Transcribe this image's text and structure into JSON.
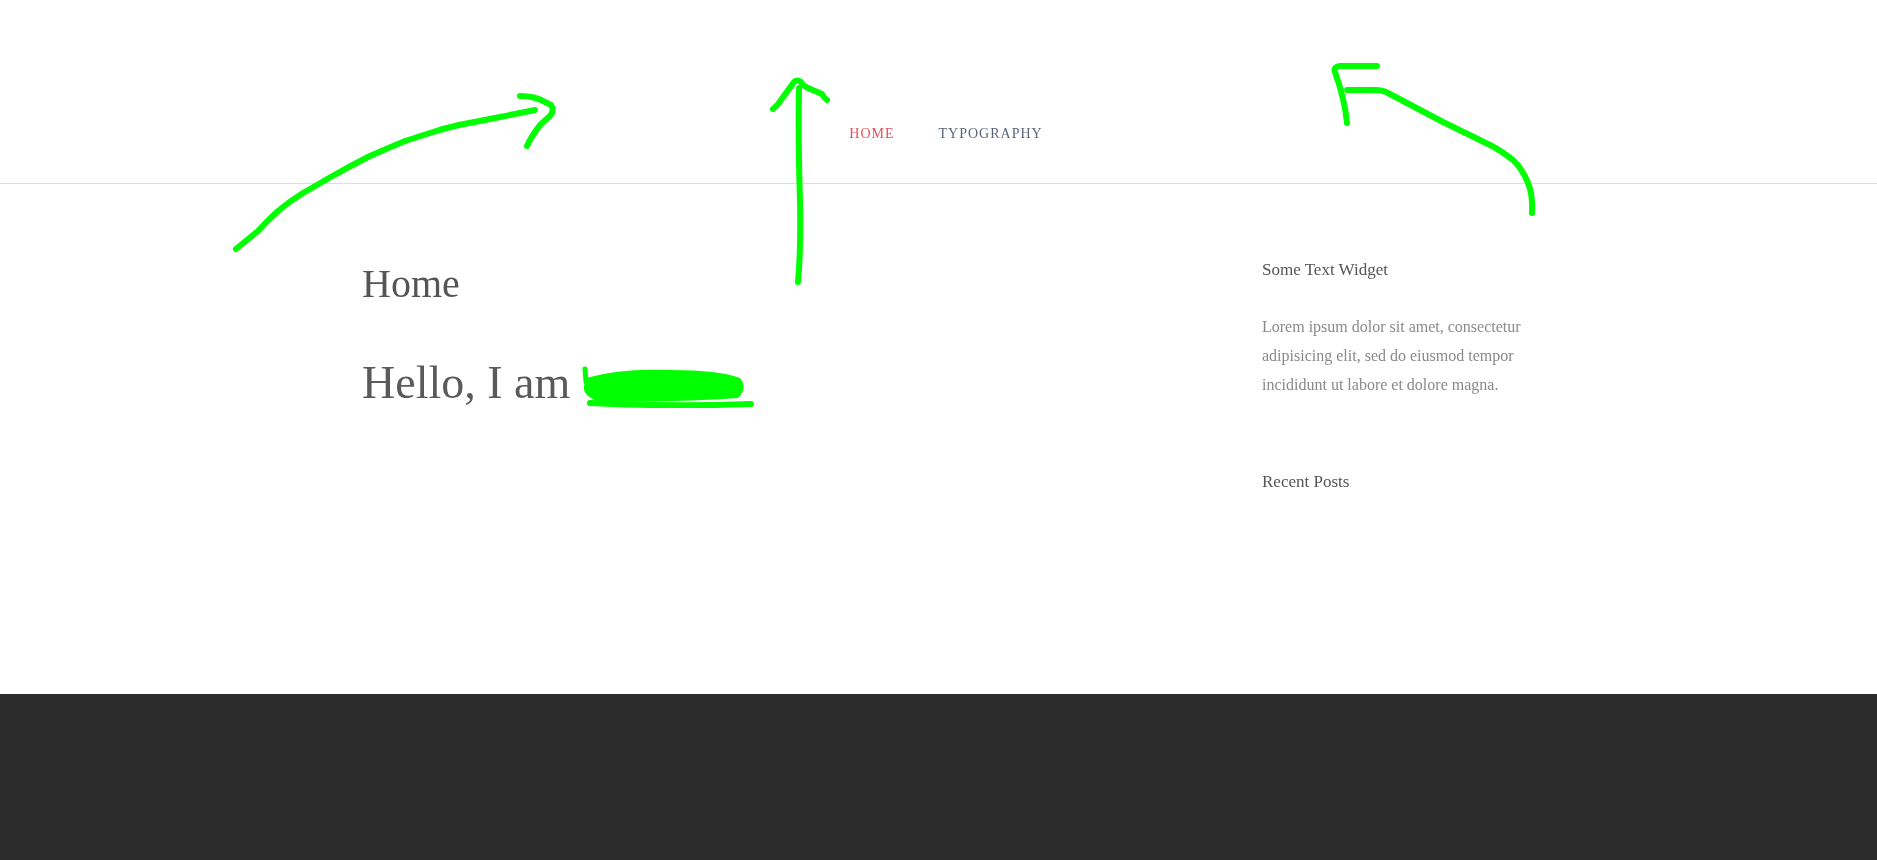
{
  "header": {
    "nav": [
      {
        "label": "HOME",
        "selected": true
      },
      {
        "label": "TYPOGRAPHY",
        "selected": false
      }
    ]
  },
  "main": {
    "page_title": "Home",
    "heading": "Hello, I am"
  },
  "sidebar": {
    "widgets": [
      {
        "kind": "text",
        "title": "Some Text Widget",
        "text": "Lorem ipsum dolor sit amet, consectetur adipisicing elit, sed do eiusmod tempor incididunt ut labore et dolore magna."
      },
      {
        "kind": "list",
        "title": "Recent Posts"
      }
    ]
  }
}
